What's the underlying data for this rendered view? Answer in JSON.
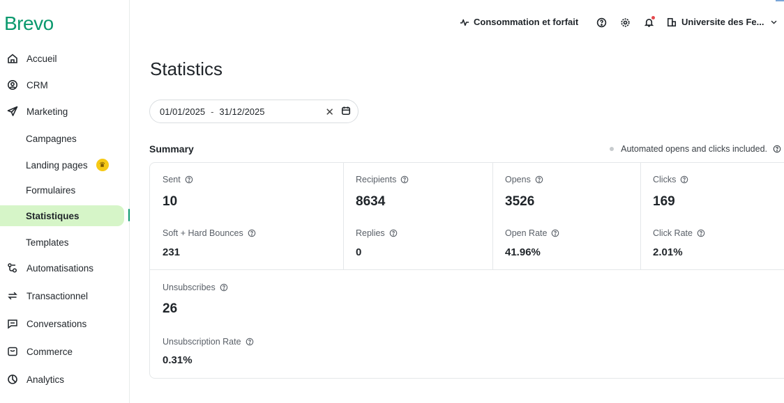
{
  "brand": {
    "logo": "Brevo",
    "accent": "#0b996e",
    "active_bg": "#d6f5c8"
  },
  "sidebar": {
    "items": [
      {
        "label": "Accueil",
        "icon": "home-icon"
      },
      {
        "label": "CRM",
        "icon": "contacts-icon"
      },
      {
        "label": "Marketing",
        "icon": "send-icon"
      },
      {
        "label": "Campagnes"
      },
      {
        "label": "Landing pages",
        "badge_icon": "crown-icon"
      },
      {
        "label": "Formulaires"
      },
      {
        "label": "Statistiques",
        "active": true
      },
      {
        "label": "Templates"
      },
      {
        "label": "Automatisations",
        "icon": "automation-icon"
      },
      {
        "label": "Transactionnel",
        "icon": "transfer-icon"
      },
      {
        "label": "Conversations",
        "icon": "chat-icon"
      },
      {
        "label": "Commerce",
        "icon": "shop-icon"
      },
      {
        "label": "Analytics",
        "icon": "pie-chart-icon"
      }
    ]
  },
  "topbar": {
    "plan_label": "Consommation et forfait",
    "account_label": "Universite des Fe..."
  },
  "main": {
    "title": "Statistics",
    "date_range": {
      "start": "01/01/2025",
      "separator": "-",
      "end": "31/12/2025"
    },
    "summary_title": "Summary",
    "automated_note": "Automated opens and clicks included.",
    "stats": {
      "sent": {
        "label": "Sent",
        "value": "10"
      },
      "recipients": {
        "label": "Recipients",
        "value": "8634"
      },
      "opens": {
        "label": "Opens",
        "value": "3526"
      },
      "clicks": {
        "label": "Clicks",
        "value": "169"
      },
      "bounces": {
        "label": "Soft + Hard Bounces",
        "value": "231"
      },
      "replies": {
        "label": "Replies",
        "value": "0"
      },
      "open_rate": {
        "label": "Open Rate",
        "value": "41.96%"
      },
      "click_rate": {
        "label": "Click Rate",
        "value": "2.01%"
      },
      "unsubscribes": {
        "label": "Unsubscribes",
        "value": "26"
      },
      "unsub_rate": {
        "label": "Unsubscription Rate",
        "value": "0.31%"
      }
    }
  }
}
